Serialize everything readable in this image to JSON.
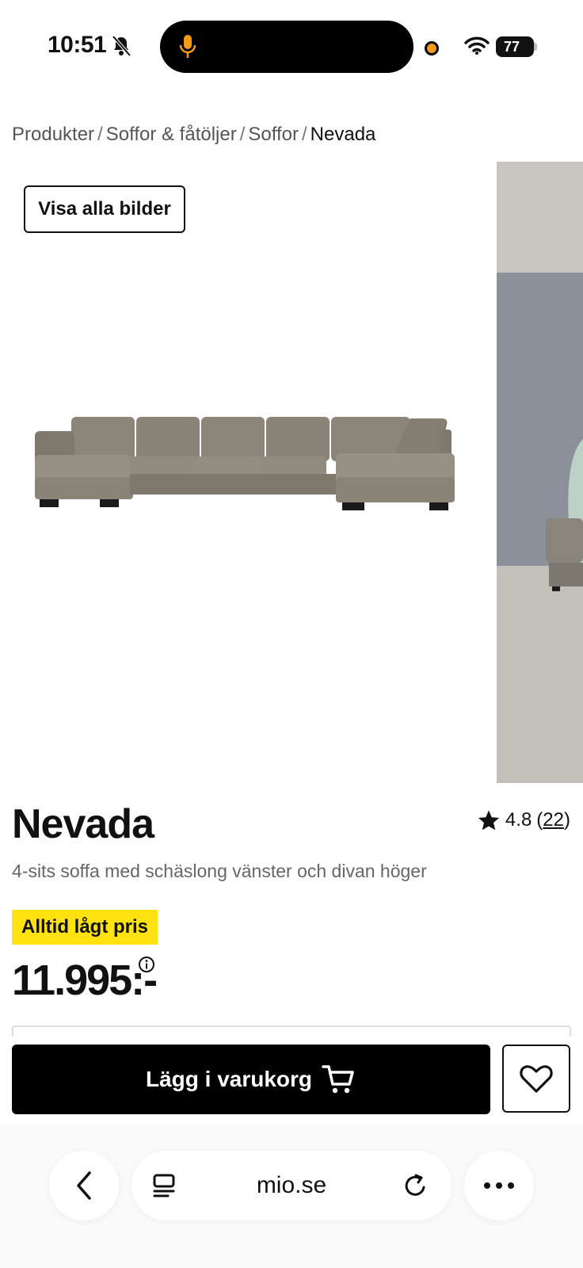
{
  "status_bar": {
    "time": "10:51",
    "battery": "77"
  },
  "breadcrumb": {
    "items": [
      "Produkter",
      "Soffor & fåtöljer",
      "Soffor"
    ],
    "separator": "/",
    "current": "Nevada"
  },
  "gallery": {
    "show_all_label": "Visa alla bilder"
  },
  "product": {
    "title": "Nevada",
    "rating": "4.8",
    "review_count_open": "(",
    "review_count": "22",
    "review_count_close": ")",
    "subtitle": "4-sits soffa med schäslong vänster och divan höger",
    "badge": "Alltid lågt pris",
    "price": "11.995:-"
  },
  "actions": {
    "add_to_cart_label": "Lägg i varukorg"
  },
  "browser": {
    "url": "mio.se"
  },
  "colors": {
    "badge_yellow": "#ffe20f",
    "accent_orange": "#f29a1b",
    "button_black": "#000000"
  }
}
